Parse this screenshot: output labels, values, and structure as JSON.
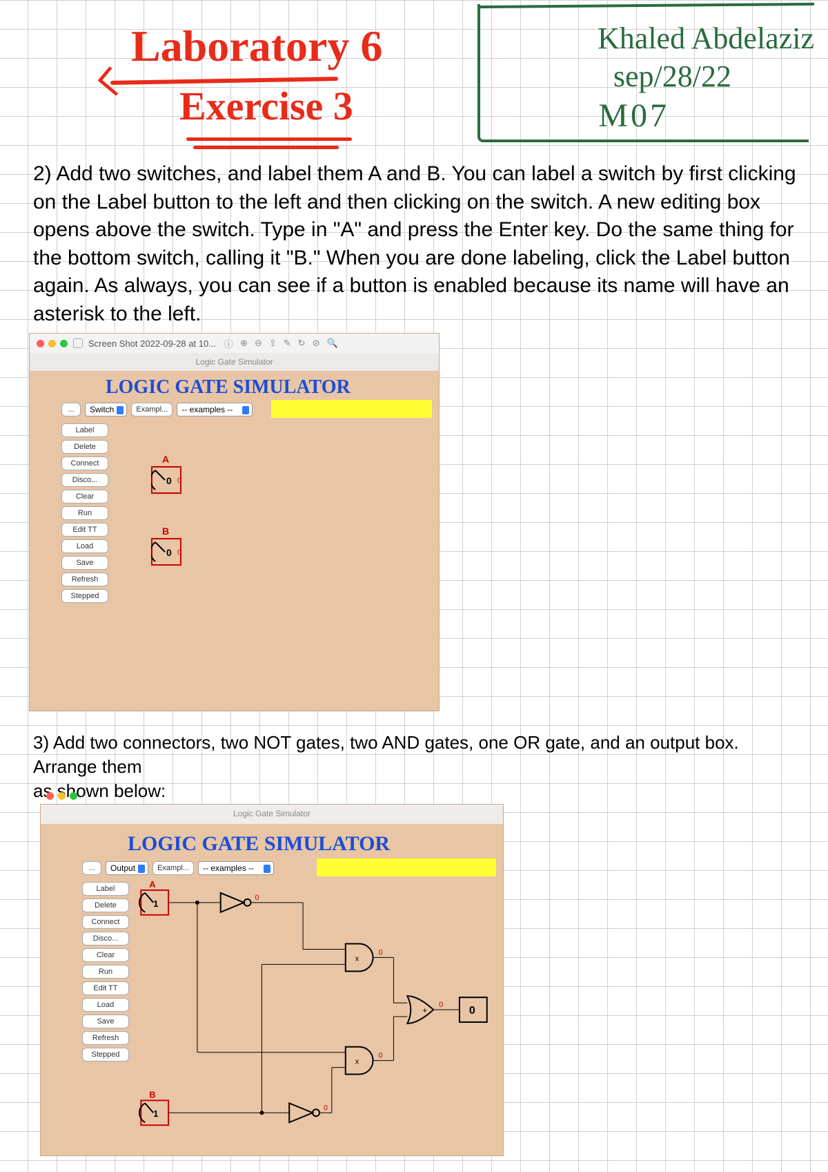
{
  "handwriting": {
    "title_line1": "Laboratory 6",
    "title_line2": "Exercise 3",
    "name": "Khaled Abdelaziz",
    "date": "sep/28/22",
    "section": "M07"
  },
  "instructions": {
    "step2": "2) Add two switches, and label them A and B. You can label a switch by first clicking on the Label button to the left and then clicking on the switch. A new editing box opens above the switch. Type in \"A\" and press the Enter key. Do the same thing for the bottom switch, calling it \"B.\" When you are done labeling, click the Label button again. As always, you can see if a button is enabled because its name will have an asterisk to the left.",
    "step3": "3) Add two connectors, two NOT gates, two AND gates, one OR gate, and an output box. Arrange them\nas shown below:"
  },
  "window1": {
    "mac_title": "Screen Shot 2022-09-28 at 10...",
    "sub_title": "Logic Gate Simulator",
    "app_title": "LOGIC GATE SIMULATOR",
    "dropdown_component": "Switch",
    "dropdown_example_btn": "Exampl...",
    "dropdown_examples": "-- examples --",
    "sidebar": [
      "...",
      "Label",
      "Delete",
      "Connect",
      "Disco...",
      "Clear",
      "Run",
      "Edit TT",
      "Load",
      "Save",
      "Refresh",
      "Stepped"
    ],
    "switchA_label": "A",
    "switchA_value": "0",
    "switchB_label": "B",
    "switchB_value": "0"
  },
  "window2": {
    "sub_title": "Logic Gate Simulator",
    "app_title": "LOGIC GATE SIMULATOR",
    "dropdown_component": "Output",
    "dropdown_example_btn": "Exampl...",
    "dropdown_examples": "-- examples --",
    "sidebar": [
      "...",
      "Label",
      "Delete",
      "Connect",
      "Disco...",
      "Clear",
      "Run",
      "Edit TT",
      "Load",
      "Save",
      "Refresh",
      "Stepped"
    ],
    "switchA_label": "A",
    "switchA_value": "1",
    "switchB_label": "B",
    "switchB_value": "1",
    "not1_out": "0",
    "not2_out": "0",
    "and1_out": "0",
    "and2_out": "0",
    "or_out": "0",
    "output_value": "0"
  }
}
